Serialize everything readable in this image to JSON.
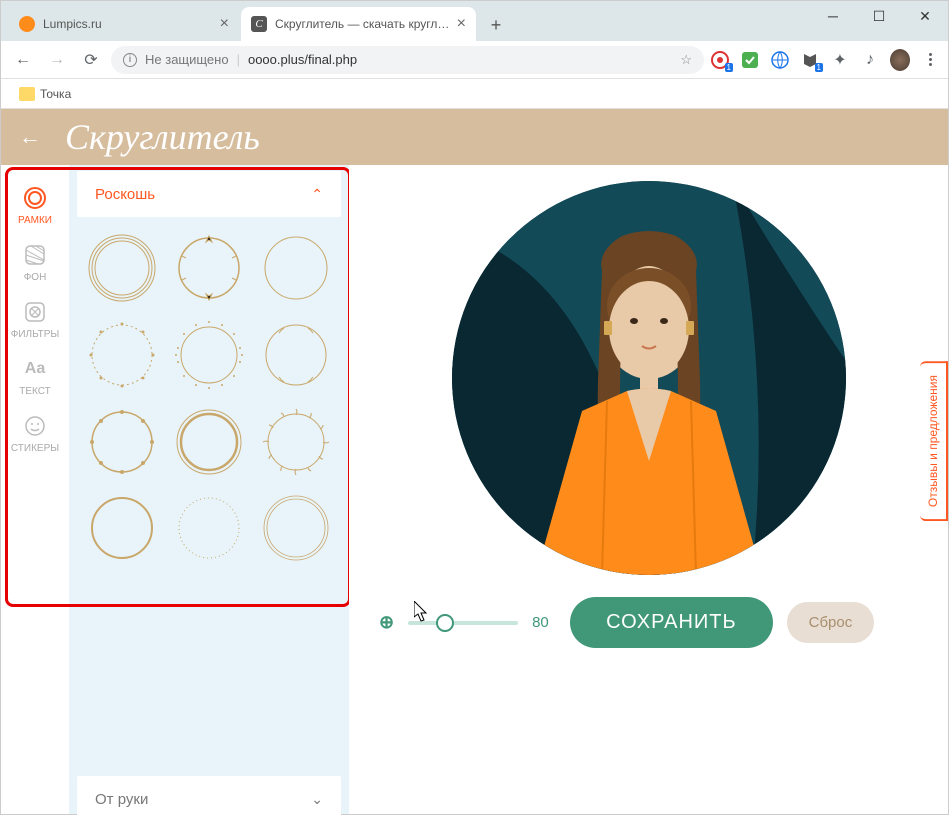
{
  "tabs": [
    {
      "title": "Lumpics.ru",
      "favicon_color": "#ff8c1a",
      "active": false
    },
    {
      "title": "Скруглитель — скачать круглую",
      "favicon_letter": "C",
      "active": true
    }
  ],
  "address": {
    "security_label": "Не защищено",
    "url": "oooo.plus/final.php"
  },
  "bookmarks": [
    {
      "label": "Точка"
    }
  ],
  "app": {
    "title": "Скруглитель"
  },
  "sidebar": [
    {
      "id": "frames",
      "label": "РАМКИ",
      "active": true
    },
    {
      "id": "background",
      "label": "ФОН",
      "active": false
    },
    {
      "id": "filters",
      "label": "ФИЛЬТРЫ",
      "active": false
    },
    {
      "id": "text",
      "label": "ТЕКСТ",
      "active": false
    },
    {
      "id": "stickers",
      "label": "СТИКЕРЫ",
      "active": false
    }
  ],
  "categories": {
    "open": {
      "label": "Роскошь"
    },
    "closed": {
      "label": "От руки"
    }
  },
  "controls": {
    "zoom_value": "80",
    "save_label": "СОХРАНИТЬ",
    "reset_label": "Сброс"
  },
  "feedback_label": "Отзывы и предложения"
}
